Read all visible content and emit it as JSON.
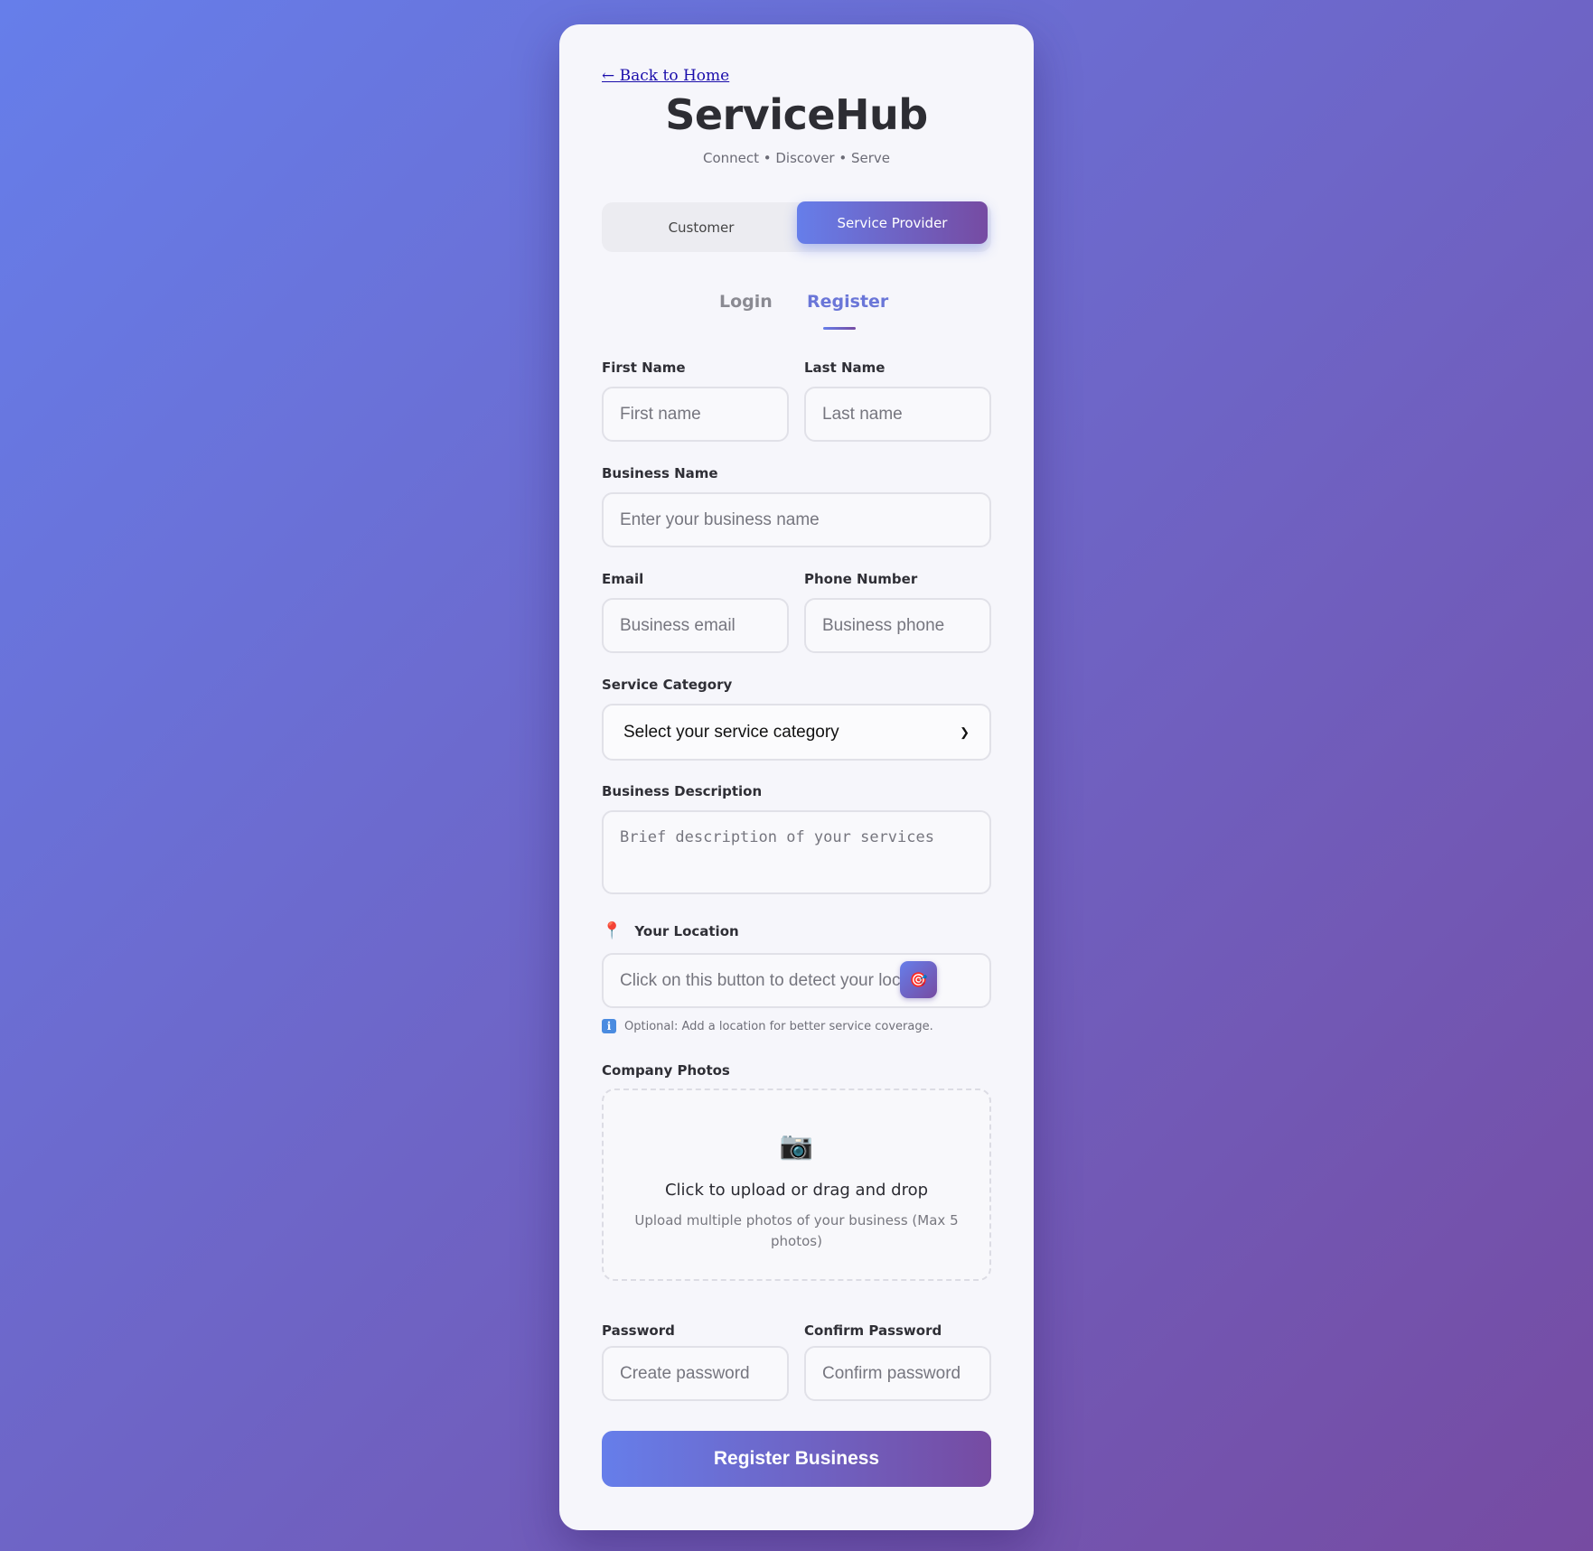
{
  "nav": {
    "back_label": "← Back to Home"
  },
  "brand": {
    "name": "ServiceHub",
    "tagline": "Connect • Discover • Serve"
  },
  "role_toggle": {
    "customer": "Customer",
    "provider": "Service Provider",
    "active": "provider"
  },
  "auth_tabs": {
    "login": "Login",
    "register": "Register",
    "active": "register"
  },
  "form": {
    "first_name": {
      "label": "First Name",
      "placeholder": "First name"
    },
    "last_name": {
      "label": "Last Name",
      "placeholder": "Last name"
    },
    "business_name": {
      "label": "Business Name",
      "placeholder": "Enter your business name"
    },
    "email": {
      "label": "Email",
      "placeholder": "Business email"
    },
    "phone": {
      "label": "Phone Number",
      "placeholder": "Business phone"
    },
    "category": {
      "label": "Service Category",
      "selected": "Select your service category"
    },
    "description": {
      "label": "Business Description",
      "placeholder": "Brief description of your services"
    },
    "location": {
      "label": "Your Location",
      "placeholder": "Click on this button to detect your location",
      "hint": "Optional: Add a location for better service coverage.",
      "icon": "pin-icon",
      "button_icon": "target-icon"
    },
    "photos": {
      "label": "Company Photos",
      "icon": "camera-icon",
      "title": "Click to upload or drag and drop",
      "subtitle": "Upload multiple photos of your business (Max 5 photos)"
    },
    "password": {
      "label": "Password",
      "placeholder": "Create password"
    },
    "confirm_password": {
      "label": "Confirm Password",
      "placeholder": "Confirm password"
    },
    "submit_label": "Register Business"
  },
  "colors": {
    "gradient_start": "#667eea",
    "gradient_end": "#764ba2",
    "accent_text": "#6a76d8"
  }
}
